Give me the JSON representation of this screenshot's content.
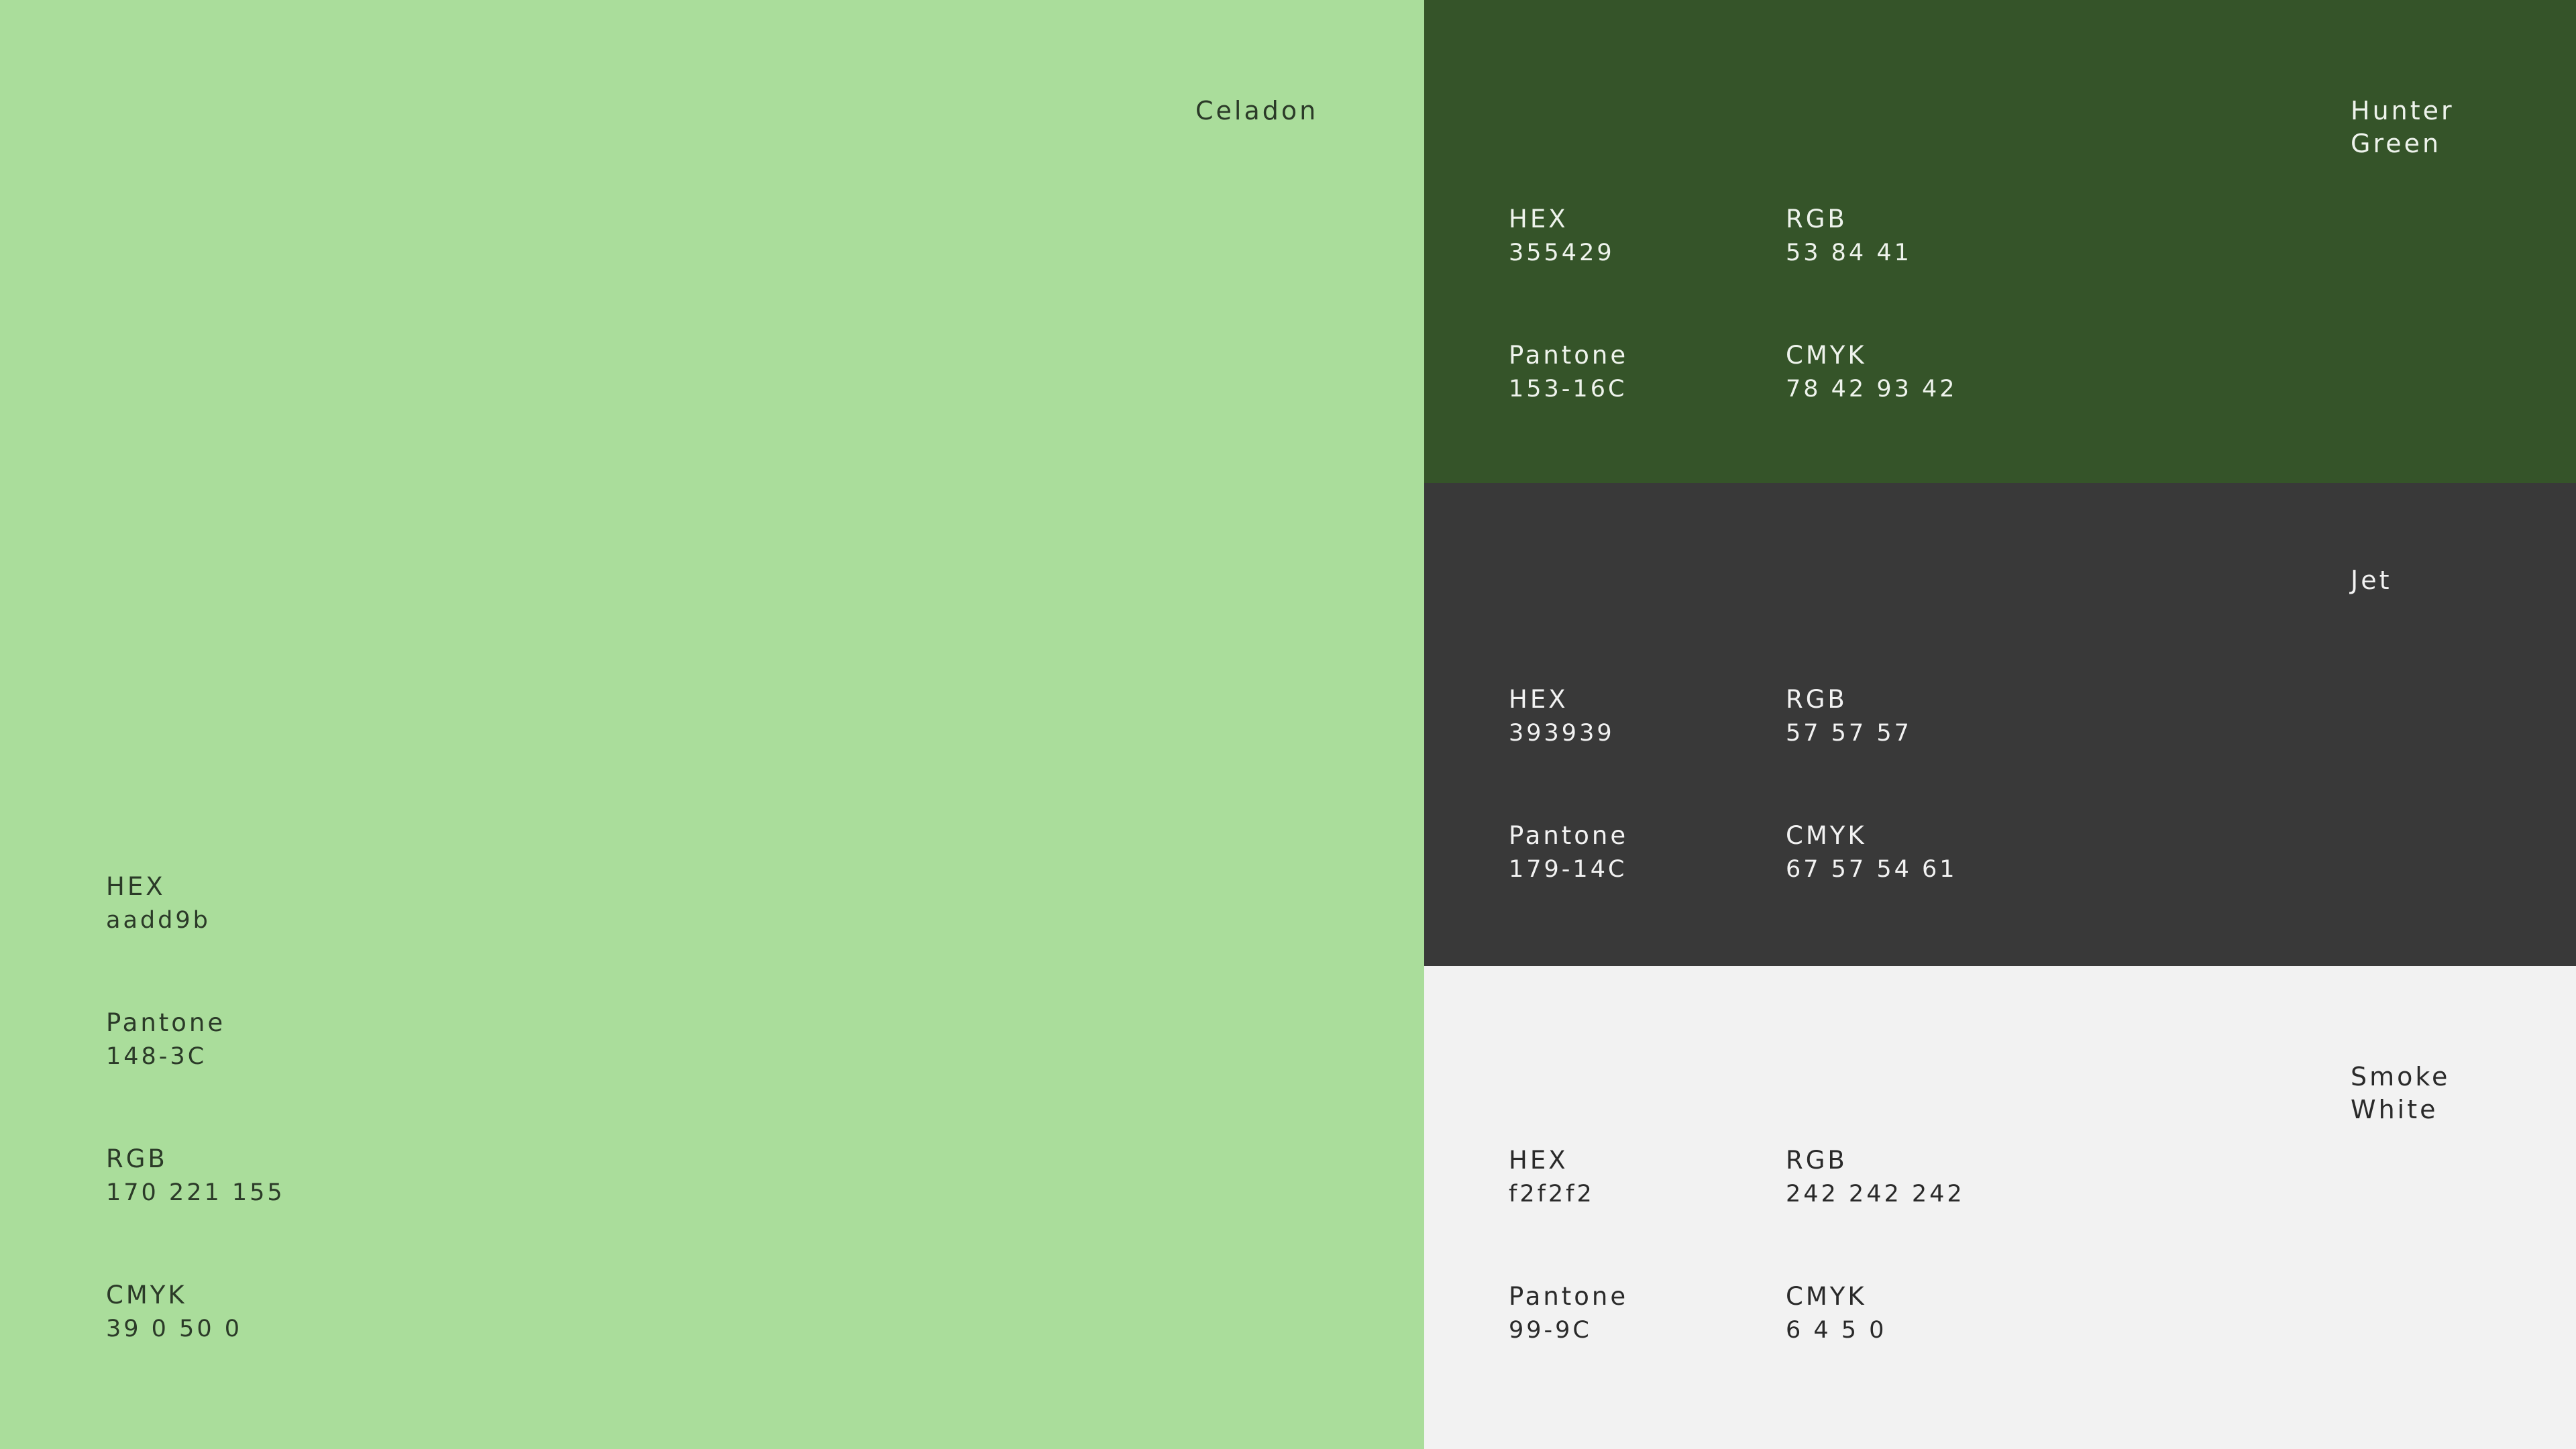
{
  "palette": {
    "main": {
      "name": "Celadon",
      "background": "#aadd9b",
      "hex_label": "HEX",
      "hex_value": "aadd9b",
      "pantone_label": "Pantone",
      "pantone_value": "148-3C",
      "rgb_label": "RGB",
      "rgb_value": "170 221 155",
      "cmyk_label": "CMYK",
      "cmyk_value": "39 0 50 0"
    },
    "hunter": {
      "name": "Hunter\nGreen",
      "background": "#355429",
      "hex_label": "HEX",
      "hex_value": "355429",
      "rgb_label": "RGB",
      "rgb_value": "53 84 41",
      "pantone_label": "Pantone",
      "pantone_value": "153-16C",
      "cmyk_label": "CMYK",
      "cmyk_value": "78 42 93 42"
    },
    "jet": {
      "name": "Jet",
      "background": "#393939",
      "hex_label": "HEX",
      "hex_value": "393939",
      "rgb_label": "RGB",
      "rgb_value": "57 57 57",
      "pantone_label": "Pantone",
      "pantone_value": "179-14C",
      "cmyk_label": "CMYK",
      "cmyk_value": "67 57 54 61"
    },
    "smoke": {
      "name": "Smoke\nWhite",
      "background": "#f2f2f2",
      "hex_label": "HEX",
      "hex_value": "f2f2f2",
      "rgb_label": "RGB",
      "rgb_value": "242 242 242",
      "pantone_label": "Pantone",
      "pantone_value": "99-9C",
      "cmyk_label": "CMYK",
      "cmyk_value": "6 4 5 0"
    }
  }
}
